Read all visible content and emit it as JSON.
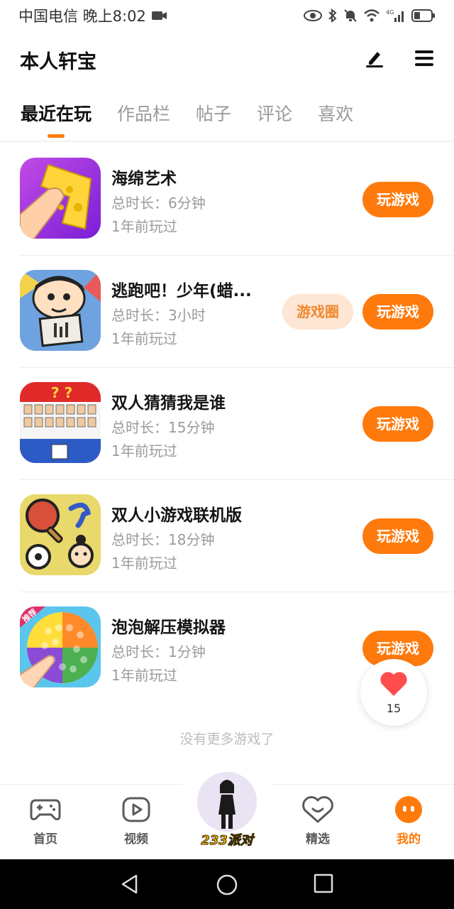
{
  "status_bar": {
    "carrier_time": "中国电信 晚上8:02",
    "network": "4G"
  },
  "header": {
    "title": "本人轩宝"
  },
  "tabs": [
    {
      "label": "最近在玩",
      "active": true
    },
    {
      "label": "作品栏",
      "active": false
    },
    {
      "label": "帖子",
      "active": false
    },
    {
      "label": "评论",
      "active": false
    },
    {
      "label": "喜欢",
      "active": false
    }
  ],
  "games": [
    {
      "name": "海绵艺术",
      "duration": "总时长：6分钟",
      "last_played": "1年前玩过",
      "play_label": "玩游戏"
    },
    {
      "name": "逃跑吧！少年(蜡...",
      "duration": "总时长：3小时",
      "last_played": "1年前玩过",
      "play_label": "玩游戏",
      "circle_label": "游戏圈"
    },
    {
      "name": "双人猜猜我是谁",
      "duration": "总时长：15分钟",
      "last_played": "1年前玩过",
      "play_label": "玩游戏"
    },
    {
      "name": "双人小游戏联机版",
      "duration": "总时长：18分钟",
      "last_played": "1年前玩过",
      "play_label": "玩游戏"
    },
    {
      "name": "泡泡解压模拟器",
      "duration": "总时长：1分钟",
      "last_played": "1年前玩过",
      "play_label": "玩游戏",
      "badge": "推荐"
    }
  ],
  "list_footer": "没有更多游戏了",
  "like_float": {
    "count": "15"
  },
  "bottom_nav": {
    "home": "首页",
    "video": "视频",
    "center": "233派对",
    "featured": "精选",
    "mine": "我的"
  },
  "colors": {
    "accent": "#ff7a0c",
    "circle_bg": "#fde6d4",
    "muted_text": "#9b9b9b"
  }
}
